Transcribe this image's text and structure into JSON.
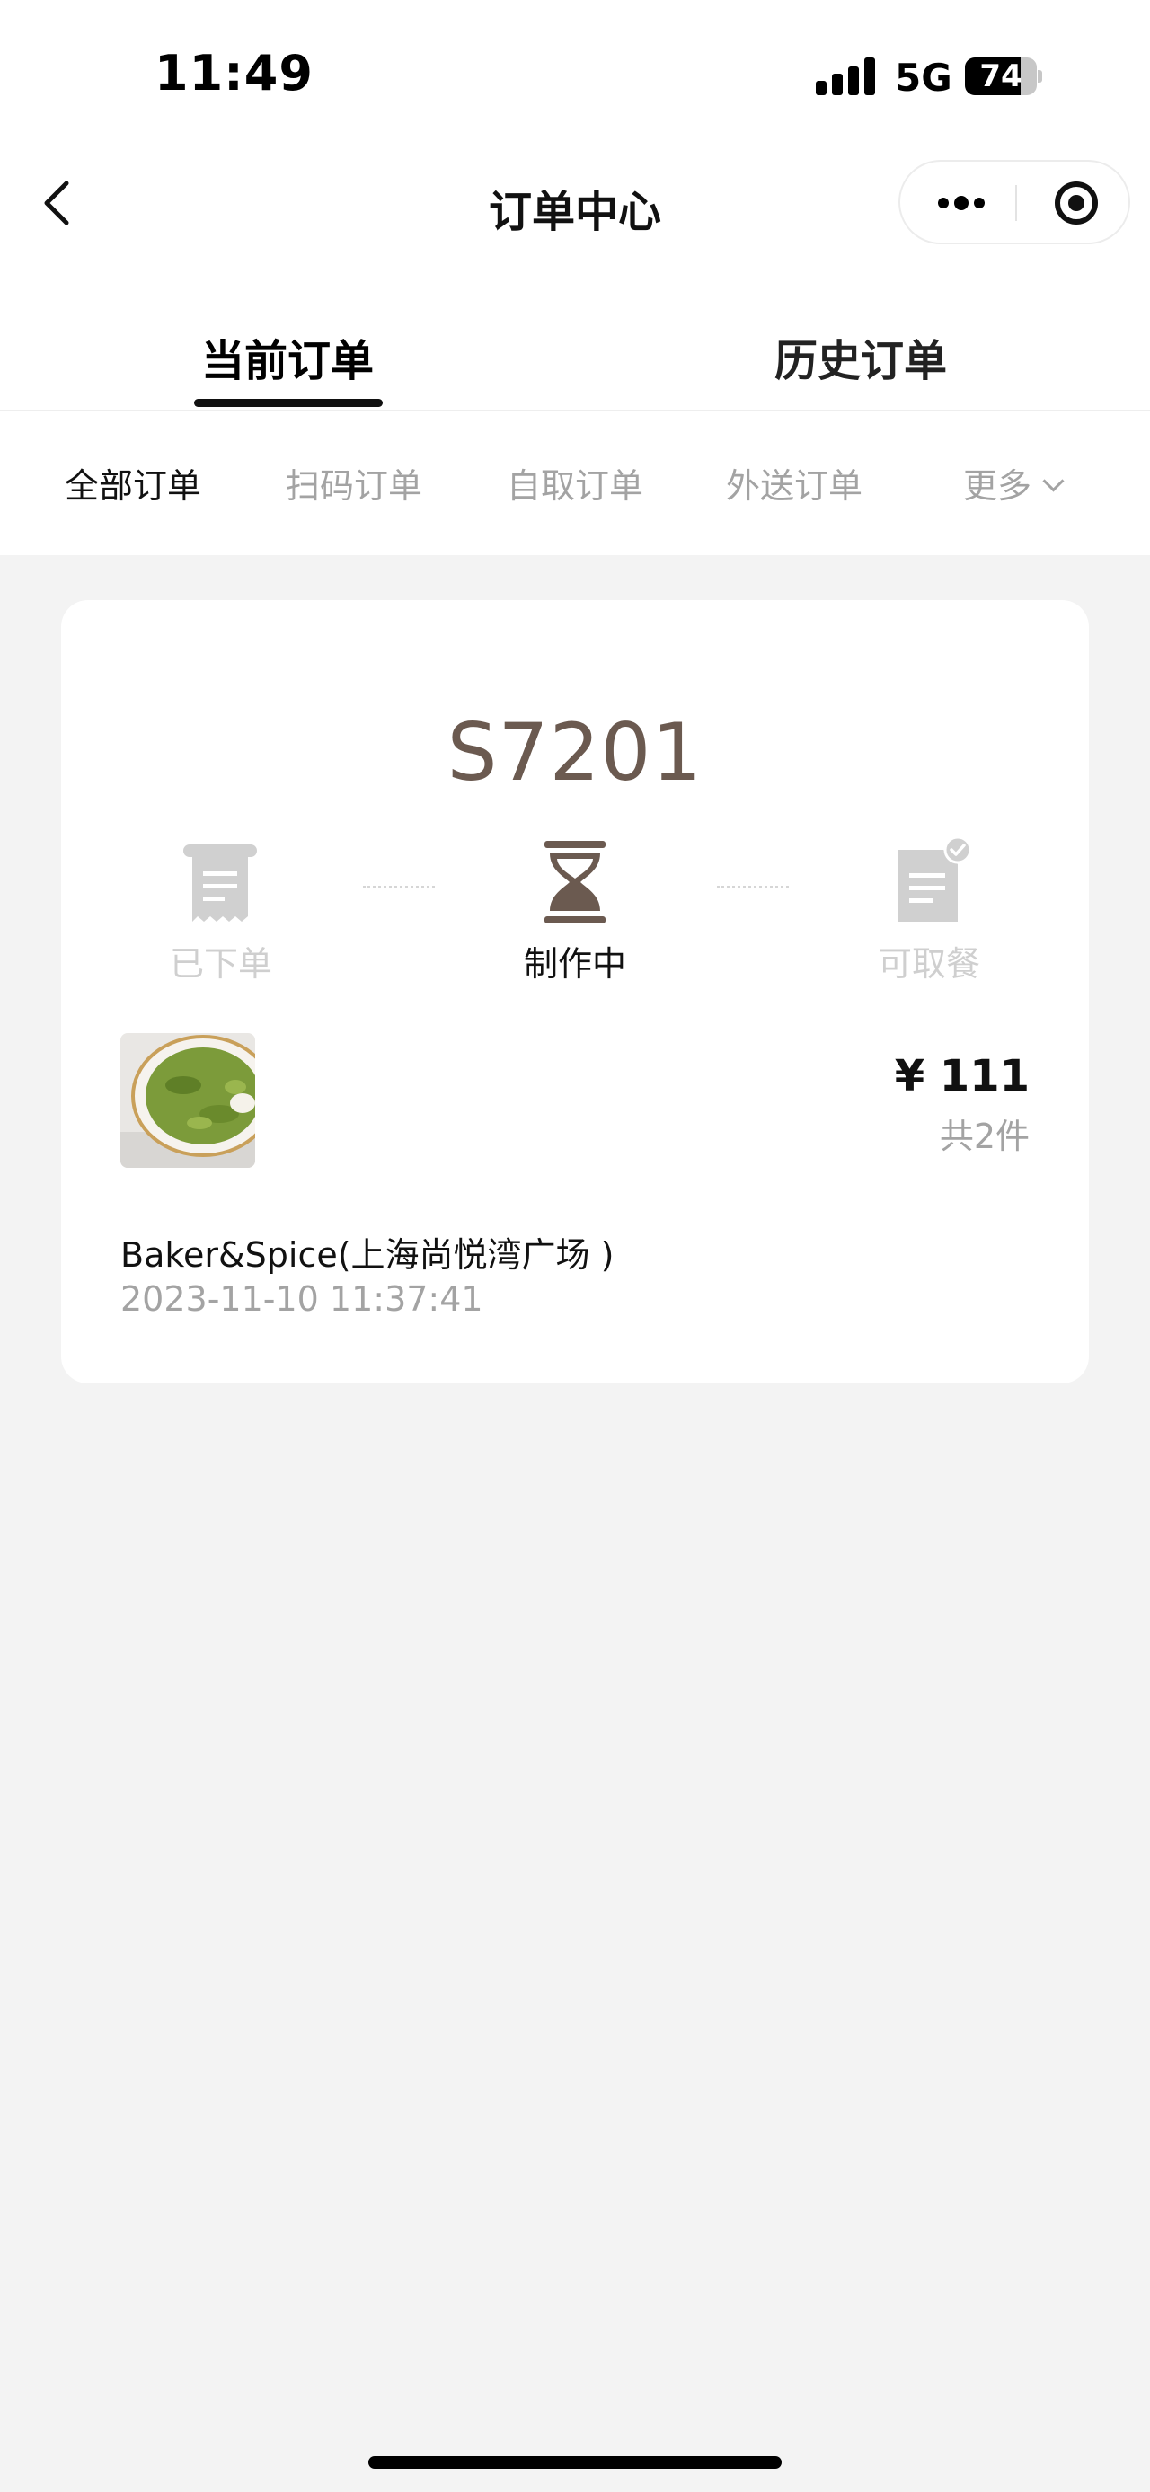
{
  "status_bar": {
    "time": "11:49",
    "network": "5G",
    "battery": "74"
  },
  "nav": {
    "title": "订单中心",
    "back_icon": "chevron-left-icon",
    "more_icon": "more-dots-icon",
    "close_icon": "target-circle-icon"
  },
  "tabs": [
    {
      "label": "当前订单",
      "active": true
    },
    {
      "label": "历史订单",
      "active": false
    }
  ],
  "filters": [
    {
      "label": "全部订单",
      "active": true
    },
    {
      "label": "扫码订单",
      "active": false
    },
    {
      "label": "自取订单",
      "active": false
    },
    {
      "label": "外送订单",
      "active": false
    },
    {
      "label": "更多",
      "active": false
    }
  ],
  "order": {
    "number": "S7201",
    "steps": [
      {
        "label": "已下单",
        "icon": "receipt-icon",
        "state": "done"
      },
      {
        "label": "制作中",
        "icon": "hourglass-icon",
        "state": "current"
      },
      {
        "label": "可取餐",
        "icon": "ready-check-icon",
        "state": "pending"
      }
    ],
    "price": "¥ 111",
    "count": "共2件",
    "store": "Baker&Spice(上海尚悦湾广场 )",
    "time": "2023-11-10 11:37:41"
  },
  "colors": {
    "accent": "#6b5a50",
    "muted": "#a3a3a3",
    "step_inactive": "#d0d0d0"
  }
}
